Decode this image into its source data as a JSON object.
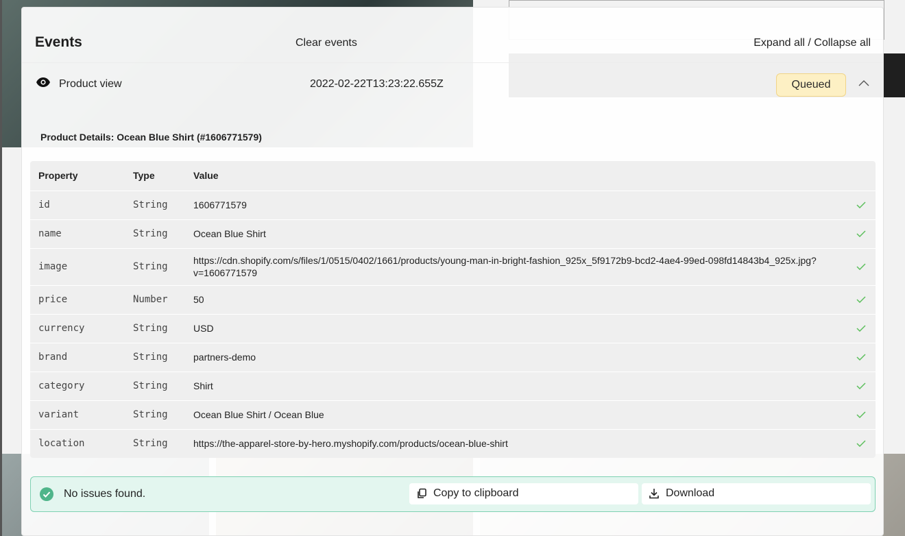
{
  "header": {
    "title": "Events",
    "clear_label": "Clear events",
    "expand_collapse_label": "Expand all / Collapse all"
  },
  "event": {
    "name": "Product view",
    "timestamp": "2022-02-22T13:23:22.655Z",
    "status": "Queued",
    "details_title": "Product Details: Ocean Blue Shirt  (#1606771579)"
  },
  "table": {
    "headers": [
      "Property",
      "Type",
      "Value"
    ],
    "rows": [
      {
        "property": "id",
        "type": "String",
        "value": "1606771579"
      },
      {
        "property": "name",
        "type": "String",
        "value": "Ocean Blue Shirt"
      },
      {
        "property": "image",
        "type": "String",
        "value": "https://cdn.shopify.com/s/files/1/0515/0402/1661/products/young-man-in-bright-fashion_925x_5f9172b9-bcd2-4ae4-99ed-098fd14843b4_925x.jpg?v=1606771579"
      },
      {
        "property": "price",
        "type": "Number",
        "value": "50"
      },
      {
        "property": "currency",
        "type": "String",
        "value": "USD"
      },
      {
        "property": "brand",
        "type": "String",
        "value": "partners-demo"
      },
      {
        "property": "category",
        "type": "String",
        "value": "Shirt"
      },
      {
        "property": "variant",
        "type": "String",
        "value": "Ocean Blue Shirt / Ocean Blue"
      },
      {
        "property": "location",
        "type": "String",
        "value": "https://the-apparel-store-by-hero.myshopify.com/products/ocean-blue-shirt"
      }
    ]
  },
  "footer": {
    "status_text": "No issues found.",
    "copy_label": "Copy to clipboard",
    "download_label": "Download"
  },
  "colors": {
    "badge_bg": "#fdf0c4",
    "success": "#4fb58a",
    "check": "#5cbf5c"
  }
}
